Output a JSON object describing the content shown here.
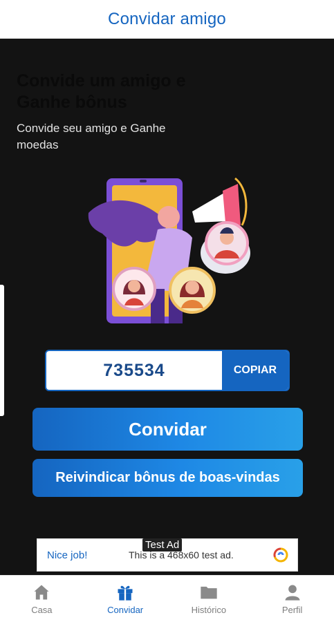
{
  "header": {
    "title": "Convidar amigo"
  },
  "intro": {
    "headline": "Convide um amigo e Ganhe bônus",
    "subline": "Convide seu amigo e Ganhe moedas"
  },
  "referral": {
    "code": "735534",
    "copy_label": "COPIAR"
  },
  "actions": {
    "invite_label": "Convidar",
    "claim_label": "Reivindicar bônus de boas-vindas"
  },
  "ad": {
    "label": "Test Ad",
    "nice": "Nice job!",
    "text": "This is a 468x60 test ad."
  },
  "nav": {
    "items": [
      {
        "label": "Casa",
        "icon": "home-icon"
      },
      {
        "label": "Convidar",
        "icon": "gift-icon",
        "active": true
      },
      {
        "label": "Histórico",
        "icon": "folder-icon"
      },
      {
        "label": "Perfil",
        "icon": "person-icon"
      }
    ]
  },
  "colors": {
    "accent": "#1565c0",
    "background": "#131313"
  }
}
